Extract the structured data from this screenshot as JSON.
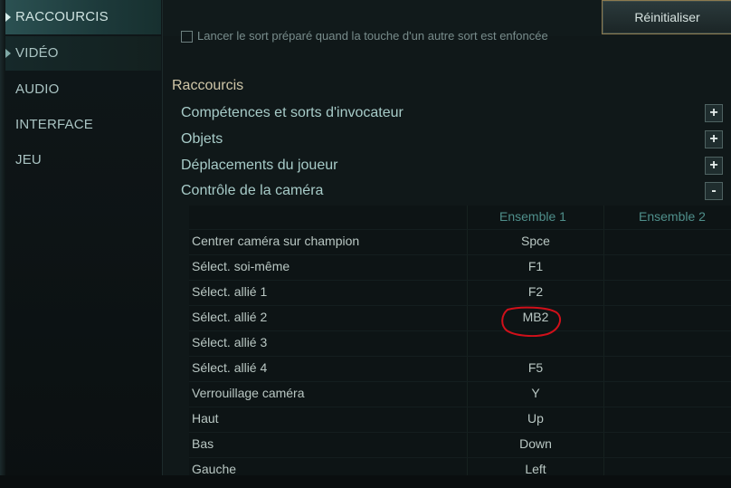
{
  "sidebar": {
    "items": [
      {
        "label": "RACCOURCIS"
      },
      {
        "label": "VIDÉO"
      },
      {
        "label": "AUDIO"
      },
      {
        "label": "INTERFACE"
      },
      {
        "label": "JEU"
      }
    ]
  },
  "header": {
    "reset_label": "Réinitialiser",
    "partial_option_label": "Lancer le sort préparé quand la touche d'un autre sort est enfoncée"
  },
  "section": {
    "title": "Raccourcis",
    "categories": [
      {
        "label": "Compétences et sorts d'invocateur",
        "toggle": "+"
      },
      {
        "label": "Objets",
        "toggle": "+"
      },
      {
        "label": "Déplacements du joueur",
        "toggle": "+"
      },
      {
        "label": "Contrôle de la caméra",
        "toggle": "-"
      }
    ]
  },
  "table": {
    "columns": [
      "Ensemble 1",
      "Ensemble 2"
    ],
    "rows": [
      {
        "action": "Centrer caméra sur champion",
        "set1": "Spce",
        "set2": ""
      },
      {
        "action": "Sélect. soi-même",
        "set1": "F1",
        "set2": ""
      },
      {
        "action": "Sélect. allié 1",
        "set1": "F2",
        "set2": ""
      },
      {
        "action": "Sélect. allié 2",
        "set1": "MB2",
        "set2": ""
      },
      {
        "action": "Sélect. allié 3",
        "set1": "",
        "set2": ""
      },
      {
        "action": "Sélect. allié 4",
        "set1": "F5",
        "set2": ""
      },
      {
        "action": "Verrouillage caméra",
        "set1": "Y",
        "set2": ""
      },
      {
        "action": "Haut",
        "set1": "Up",
        "set2": ""
      },
      {
        "action": "Bas",
        "set1": "Down",
        "set2": ""
      },
      {
        "action": "Gauche",
        "set1": "Left",
        "set2": ""
      }
    ]
  },
  "colors": {
    "accent_teal": "#4f8f8b",
    "title_gold": "#cfc6a8",
    "annotation_red": "#d0101a"
  }
}
